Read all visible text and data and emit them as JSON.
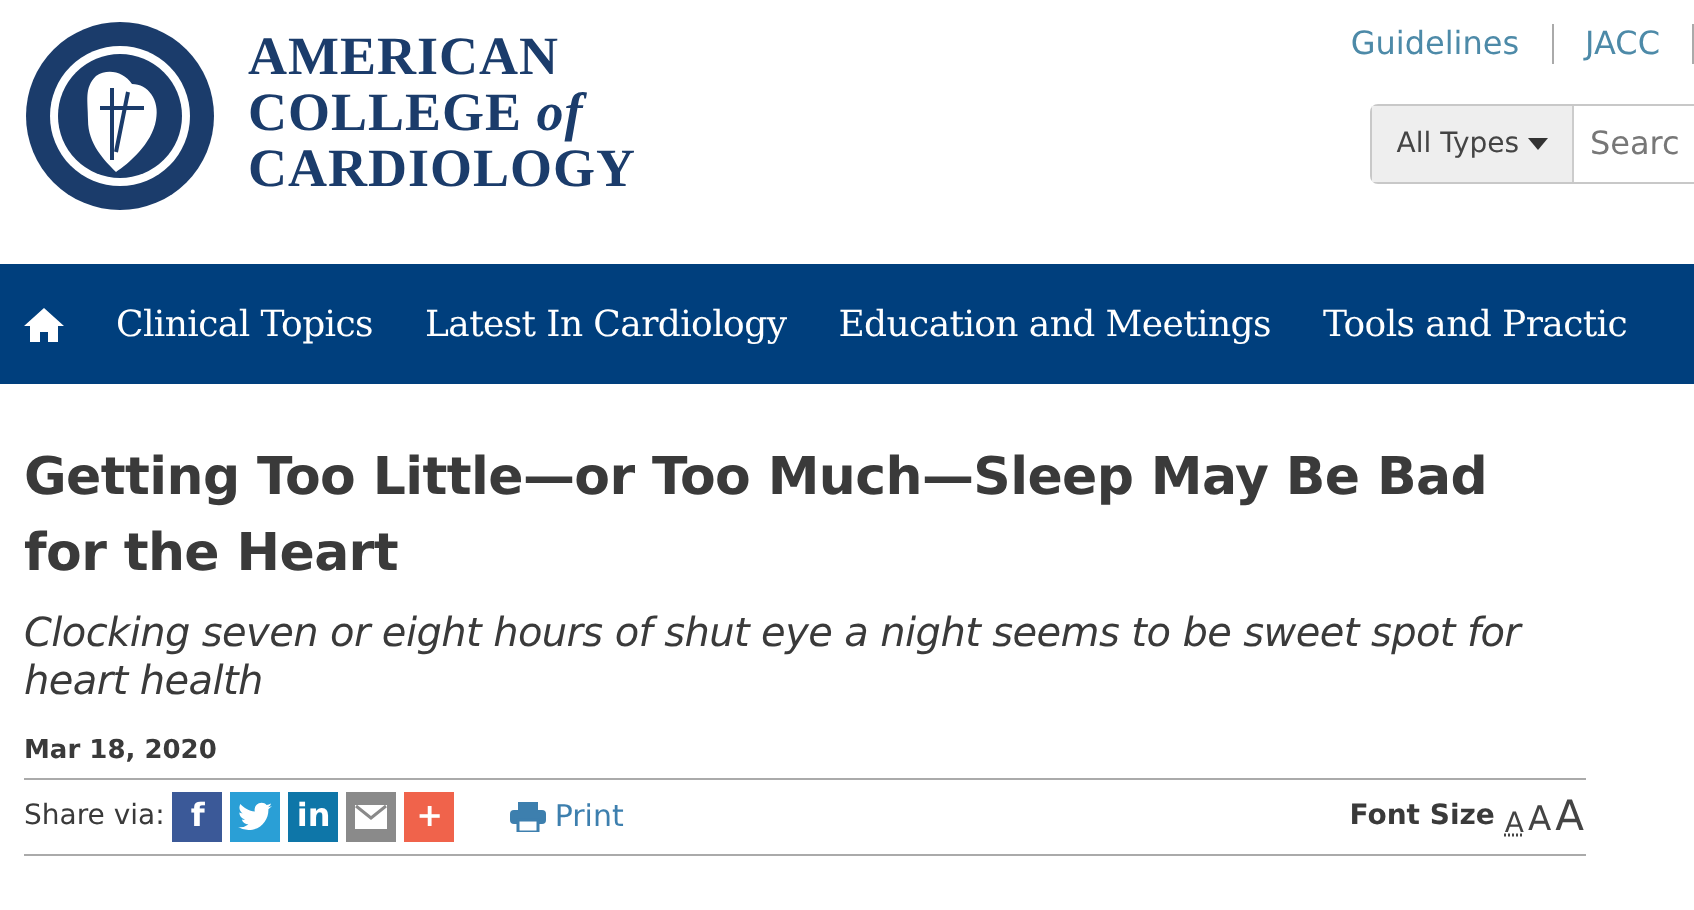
{
  "logo": {
    "lines": [
      "AMERICAN",
      "COLLEGE *of*",
      "CARDIOLOGY"
    ]
  },
  "top_links": [
    "Guidelines",
    "JACC"
  ],
  "search": {
    "filter": "All Types",
    "placeholder": "Searc"
  },
  "nav": {
    "items": [
      "Clinical Topics",
      "Latest In Cardiology",
      "Education and Meetings",
      "Tools and Practic"
    ]
  },
  "article": {
    "title": "Getting Too Little—or Too Much—Sleep May Be Bad for the Heart",
    "subtitle": "Clocking seven or eight hours of shut eye a night seems to be sweet spot for heart health",
    "date": "Mar 18, 2020"
  },
  "share": {
    "label": "Share via:",
    "buttons": [
      {
        "kind": "facebook",
        "glyph": "f",
        "color": "#3b5998"
      },
      {
        "kind": "twitter",
        "color": "#2a9fd6"
      },
      {
        "kind": "linkedin",
        "glyph": "in",
        "color": "#0e76a8"
      },
      {
        "kind": "email",
        "color": "#8a8a8a"
      },
      {
        "kind": "more",
        "glyph": "+",
        "color": "#f0634b"
      }
    ],
    "print": "Print"
  },
  "font_size": {
    "label": "Font Size",
    "options": [
      {
        "glyph": "A",
        "selected": true
      },
      {
        "glyph": "A",
        "selected": false
      },
      {
        "glyph": "A",
        "selected": false
      }
    ]
  }
}
